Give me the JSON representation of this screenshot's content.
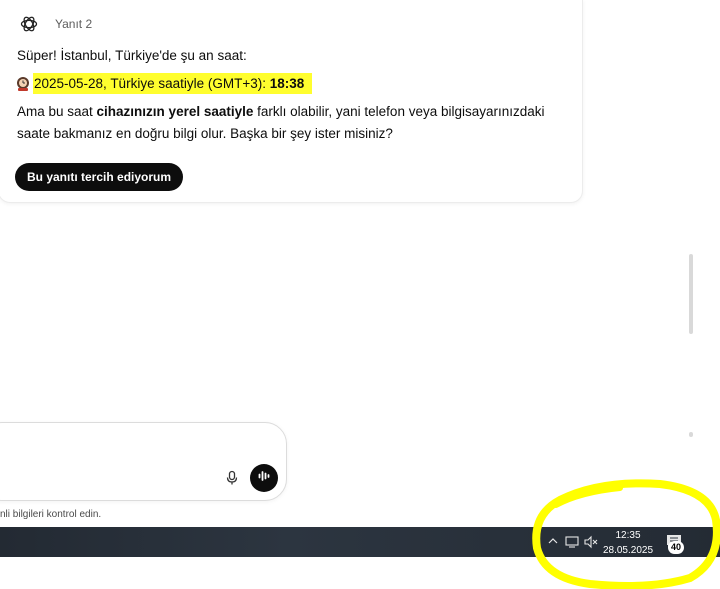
{
  "response": {
    "title": "Yanıt 2",
    "intro": "Süper! İstanbul, Türkiye'de şu an saat:",
    "time_line_prefix": "2025-05-28, Türkiye saatiyle (GMT+3): ",
    "time_line_time": "18:38",
    "para_part1": "Ama bu saat ",
    "para_bold": "cihazınızın yerel saatiyle",
    "para_part2": " farklı olabilir, yani telefon veya bilgisayarınızdaki saate bakmanız en doğru bilgi olur. Başka bir şey ister misiniz?",
    "prefer_button": "Bu yanıtı tercih ediyorum"
  },
  "composer": {
    "disclaimer": "nli bilgileri kontrol edin."
  },
  "taskbar": {
    "time": "12:35",
    "date": "28.05.2025",
    "notification_count": "40"
  },
  "icons": {
    "logo": "openai-logo-icon",
    "clock_emoji": "clock-emoji-icon",
    "mic": "microphone-icon",
    "voice": "voice-mode-icon",
    "tray": "chevron-up-icon",
    "network": "network-icon",
    "volume": "volume-muted-icon",
    "notifications": "notification-icon"
  },
  "colors": {
    "highlight": "#fffe2e",
    "annotation": "#ffff00",
    "button_bg": "#0d0d0d",
    "taskbar_bg": "#2a323c"
  }
}
